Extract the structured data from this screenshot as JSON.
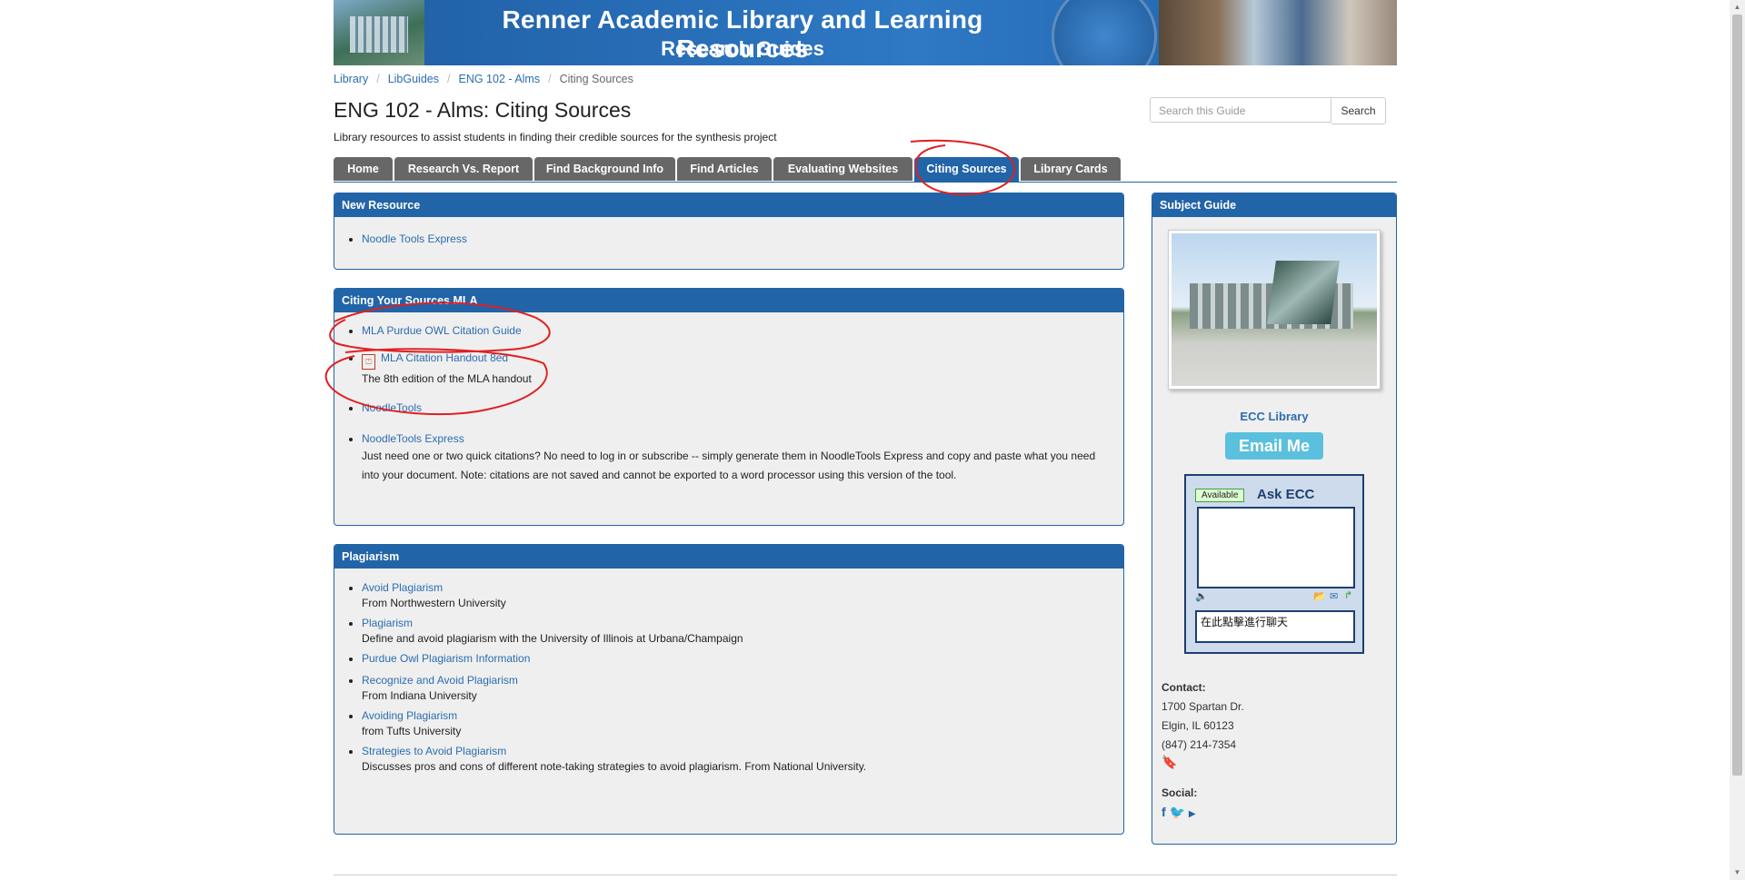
{
  "banner": {
    "title": "Renner Academic Library and Learning Resources",
    "subtitle": "Research Guides"
  },
  "breadcrumb": {
    "items": [
      "Library",
      "LibGuides",
      "ENG 102 - Alms"
    ],
    "current": "Citing Sources"
  },
  "page": {
    "title": "ENG 102 - Alms: Citing Sources",
    "description": "Library resources to assist students in finding their credible sources for the synthesis project"
  },
  "search": {
    "placeholder": "Search this Guide",
    "button": "Search"
  },
  "tabs": [
    "Home",
    "Research Vs. Report",
    "Find Background Info",
    "Find Articles",
    "Evaluating Websites",
    "Citing Sources",
    "Library Cards"
  ],
  "active_tab": "Citing Sources",
  "new_resource": {
    "heading": "New Resource",
    "items": [
      {
        "link": "Noodle Tools Express"
      }
    ]
  },
  "citing": {
    "heading": "Citing Your Sources MLA",
    "items": [
      {
        "link": "MLA Purdue OWL Citation Guide"
      },
      {
        "link": "MLA Citation Handout 8ed",
        "desc": "The 8th edition of the MLA handout",
        "icon": "pdf-icon"
      },
      {
        "link": "NoodleTools"
      },
      {
        "link": "NoodleTools Express",
        "desc1": "Just need one or two quick citations? No need to log in or subscribe -- simply generate them in NoodleTools Express and copy and paste what you need",
        "desc2": "into your document. Note: citations are not saved and cannot be exported to a word processor using this version of the tool."
      }
    ]
  },
  "plagiarism": {
    "heading": "Plagiarism",
    "items": [
      {
        "link": "Avoid Plagiarism",
        "desc": "From Northwestern University"
      },
      {
        "link": "Plagiarism",
        "desc": "Define and avoid plagiarism with the University of Illinois at Urbana/Champaign"
      },
      {
        "link": "Purdue Owl Plagiarism Information"
      },
      {
        "link": "Recognize and Avoid Plagiarism",
        "desc": "From Indiana University"
      },
      {
        "link": "Avoiding Plagiarism",
        "desc": "from Tufts University"
      },
      {
        "link": "Strategies to Avoid Plagiarism",
        "desc": "Discusses pros and cons of different note-taking strategies to avoid plagiarism. From National University."
      }
    ]
  },
  "subject_guide": {
    "heading": "Subject Guide",
    "name": "ECC Library",
    "email_button": "Email Me",
    "chat": {
      "status": "Available",
      "title": "Ask ECC",
      "input_text": "在此點擊進行聊天"
    },
    "contact_label": "Contact:",
    "address1": "1700 Spartan Dr.",
    "address2": "Elgin, IL 60123",
    "phone": "(847) 214-7354",
    "social_label": "Social:",
    "social_icons": [
      "facebook-icon",
      "twitter-icon",
      "youtube-icon"
    ]
  },
  "colors": {
    "header_blue": "#2264a8",
    "tab_gray": "#676767",
    "box_bg": "#efefef",
    "annotation_red": "#e02020"
  }
}
